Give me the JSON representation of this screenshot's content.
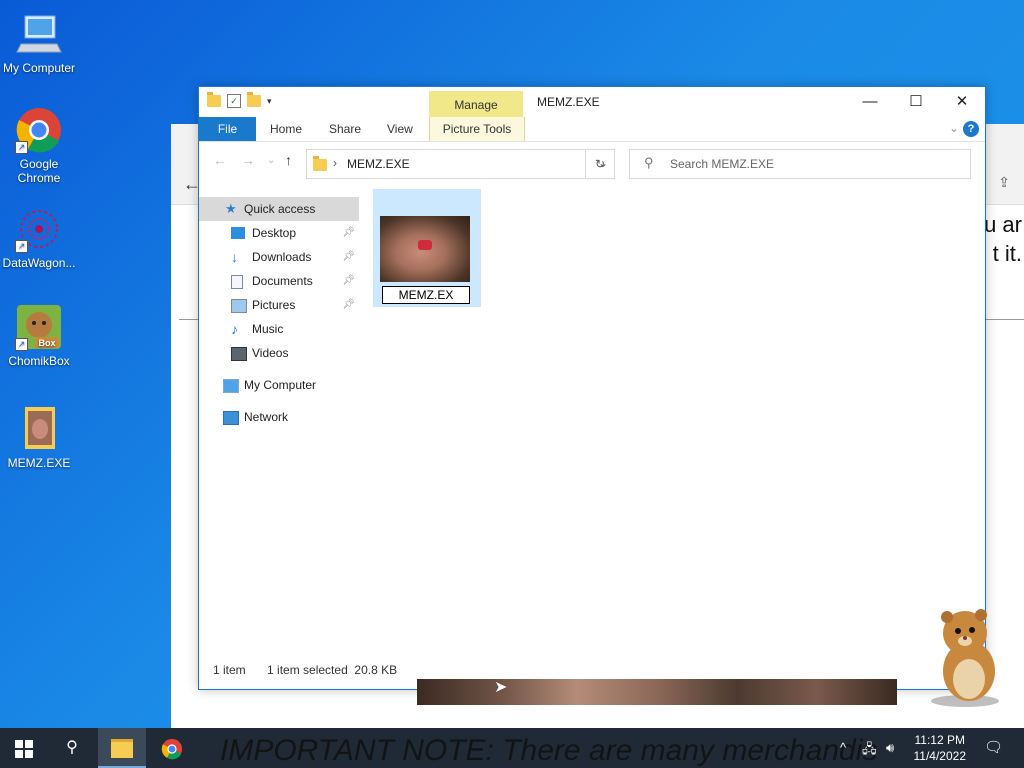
{
  "desktop": {
    "icons": [
      {
        "label": "My Computer"
      },
      {
        "label": "Google Chrome"
      },
      {
        "label": "DataWagon..."
      },
      {
        "label": "ChomikBox"
      },
      {
        "label": "MEMZ.EXE"
      }
    ]
  },
  "background_window": {
    "right_text_line1": "u ar",
    "right_text_line2": "t it.",
    "note": "IMPORTANT NOTE: There are many merchandis"
  },
  "explorer": {
    "title": "MEMZ.EXE",
    "manage_label": "Manage",
    "ribbon": {
      "file": "File",
      "home": "Home",
      "share": "Share",
      "view": "View",
      "picture_tools": "Picture Tools"
    },
    "address": {
      "path": "MEMZ.EXE",
      "search_placeholder": "Search MEMZ.EXE"
    },
    "nav": {
      "quick_access": "Quick access",
      "items": [
        {
          "label": "Desktop"
        },
        {
          "label": "Downloads"
        },
        {
          "label": "Documents"
        },
        {
          "label": "Pictures"
        },
        {
          "label": "Music"
        },
        {
          "label": "Videos"
        }
      ],
      "my_computer": "My Computer",
      "network": "Network"
    },
    "file": {
      "rename_value": "MEMZ.EX"
    },
    "status": {
      "count": "1 item",
      "selected": "1 item selected  20.8 KB"
    }
  },
  "taskbar": {
    "time": "11:12 PM",
    "date": "11/4/2022"
  },
  "colors": {
    "accent": "#1979ca",
    "manage_tab": "#f1e88a",
    "selection": "#cce8ff",
    "taskbar": "#1f2a36"
  }
}
